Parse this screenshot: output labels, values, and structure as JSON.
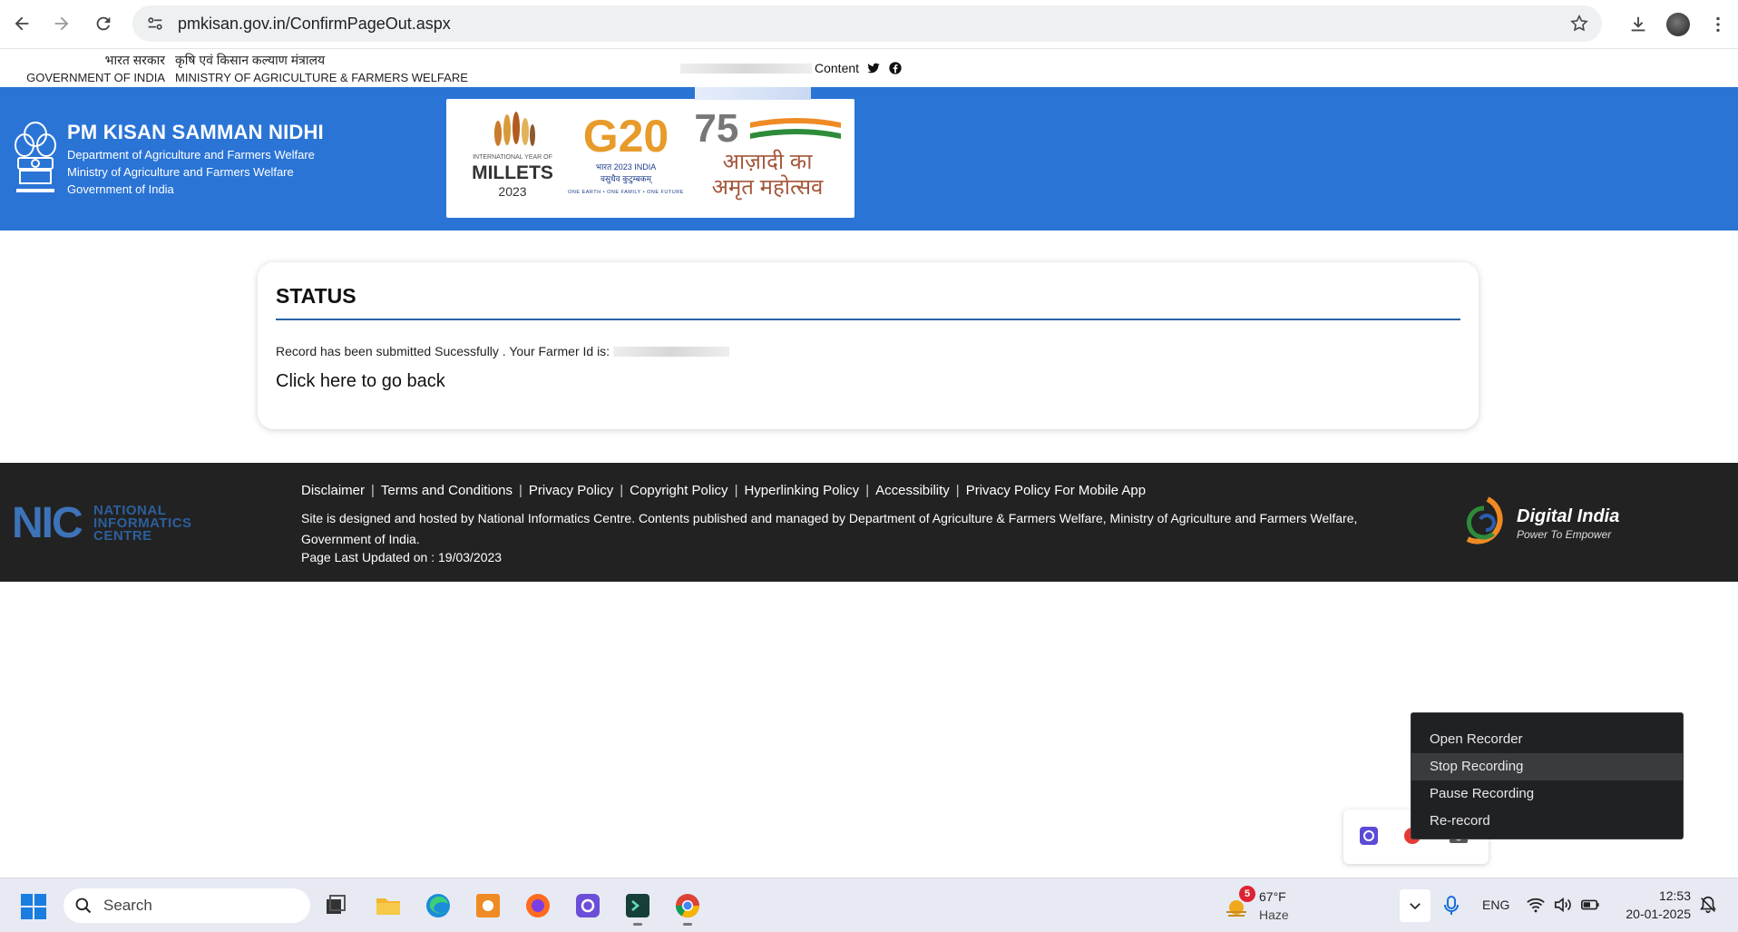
{
  "browser": {
    "url": "pmkisan.gov.in/ConfirmPageOut.aspx"
  },
  "gov_strip": {
    "col1_hindi": "भारत सरकार",
    "col1_english": "GOVERNMENT OF INDIA",
    "col2_hindi": "कृषि एवं किसान कल्याण मंत्रालय",
    "col2_english": "MINISTRY OF AGRICULTURE & FARMERS WELFARE",
    "content_label": "Content"
  },
  "header": {
    "title": "PM KISAN SAMMAN NIDHI",
    "lines": [
      "Department of Agriculture and Farmers Welfare",
      "Ministry of Agriculture and Farmers Welfare",
      "Government of India"
    ],
    "accent_color": "#2a74d6"
  },
  "logos": {
    "millets_top": "INTERNATIONAL YEAR OF",
    "millets_word": "MILLETS",
    "millets_year": "2023",
    "g20_word": "G20",
    "g20_sub": "भारत 2023 INDIA",
    "g20_hindi": "वसुधैव कुटुम्बकम्",
    "g20_motto": "ONE EARTH • ONE FAMILY • ONE FUTURE",
    "azadi_number": "75",
    "azadi_hindi_1": "आज़ादी का",
    "azadi_hindi_2": "अमृत महोत्सव"
  },
  "status": {
    "title": "STATUS",
    "message": "Record has been submitted Sucessfully . Your Farmer Id is:",
    "go_back": "Click here to go back"
  },
  "footer": {
    "nic_short": "NIC",
    "nic_long": [
      "NATIONAL",
      "INFORMATICS",
      "CENTRE"
    ],
    "links": [
      "Disclaimer",
      "Terms and Conditions",
      "Privacy Policy",
      "Copyright Policy",
      "Hyperlinking Policy",
      "Accessibility",
      "Privacy Policy For Mobile App"
    ],
    "credits": "Site is designed and hosted by National Informatics Centre. Contents published and managed by Department of Agriculture & Farmers Welfare, Ministry of Agriculture and Farmers Welfare, Government of India.",
    "updated_label": "Page Last Updated on : ",
    "updated_value": "19/03/2023",
    "digital_india_title": "Digital India",
    "digital_india_sub": "Power To Empower"
  },
  "recorder_menu": {
    "items": [
      "Open Recorder",
      "Stop Recording",
      "Pause Recording",
      "Re-record"
    ],
    "hovered": "Stop Recording"
  },
  "taskbar": {
    "search_label": "Search",
    "weather_badge": "5",
    "weather_temp": "67°F",
    "weather_condition": "Haze",
    "language": "ENG",
    "time": "12:53",
    "date": "20-01-2025",
    "apps": [
      "task-view-icon",
      "file-explorer-icon",
      "edge-icon",
      "app-orange-icon",
      "firefox-icon",
      "app-purple-icon",
      "app-terminal-icon",
      "chrome-icon"
    ]
  }
}
